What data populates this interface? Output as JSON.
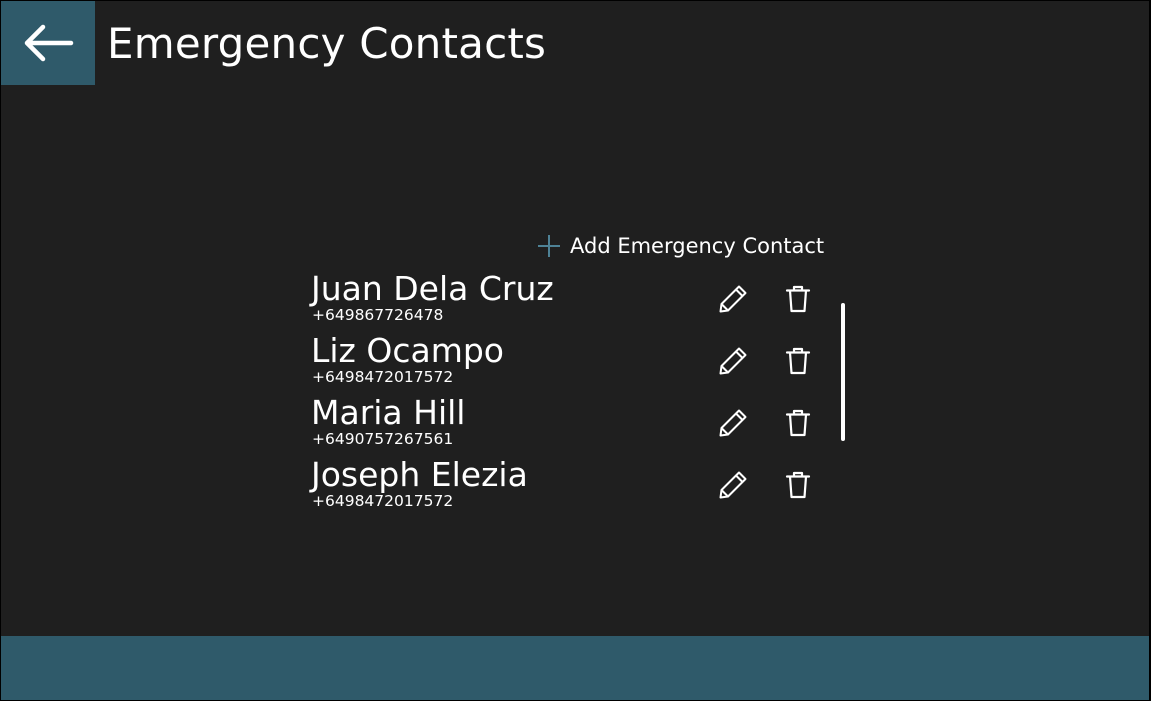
{
  "header": {
    "title": "Emergency Contacts",
    "back_icon": "arrow-left-icon"
  },
  "actions": {
    "add_label": "Add Emergency Contact",
    "add_icon": "plus-icon"
  },
  "contacts": [
    {
      "name": "Juan Dela Cruz",
      "phone": "+649867726478"
    },
    {
      "name": "Liz Ocampo",
      "phone": "+6498472017572"
    },
    {
      "name": "Maria Hill",
      "phone": "+6490757267561"
    },
    {
      "name": "Joseph Elezia",
      "phone": "+6498472017572"
    }
  ],
  "row_icons": {
    "edit": "pencil-icon",
    "delete": "trash-icon"
  },
  "colors": {
    "background": "#1f1f1f",
    "accent": "#2f5a6a",
    "text": "#ffffff",
    "add_icon": "#4e8296"
  }
}
